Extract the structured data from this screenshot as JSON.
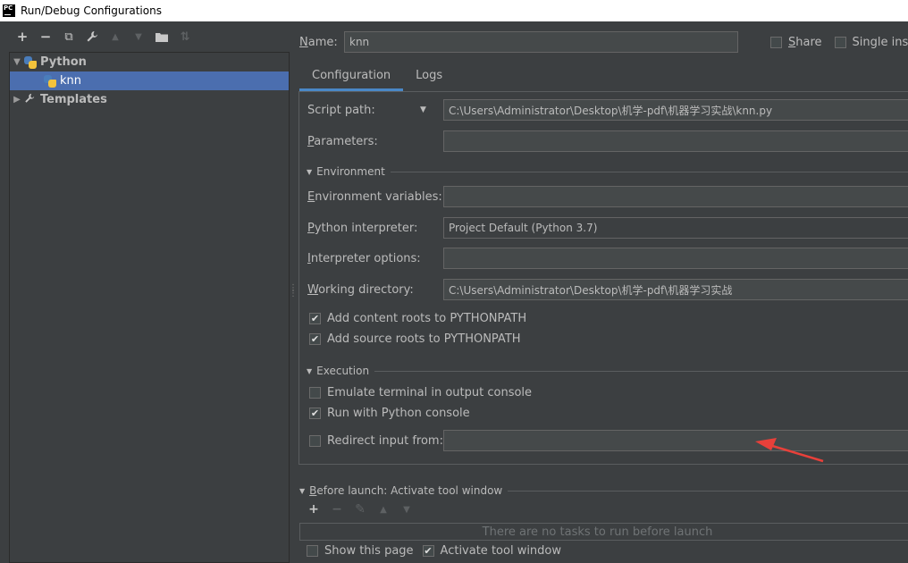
{
  "window": {
    "title": "Run/Debug Configurations",
    "logo_text": "PC"
  },
  "toolbar": {
    "add": "+",
    "remove": "−",
    "copy": "⧉",
    "edit_defaults": "🔧",
    "move_up": "▲",
    "move_down": "▼",
    "folder": "▣",
    "sort": "⇅"
  },
  "tree": {
    "python_label": "Python",
    "knn_label": "knn",
    "templates_label": "Templates"
  },
  "name_field": {
    "label": "Name:",
    "value": "knn"
  },
  "share": {
    "label": "Share",
    "checked": false
  },
  "single_instance": {
    "label": "Single instan",
    "checked": false
  },
  "tabs": [
    {
      "label": "Configuration"
    },
    {
      "label": "Logs"
    }
  ],
  "config": {
    "script_path": {
      "label": "Script path:",
      "value": "C:\\Users\\Administrator\\Desktop\\机学-pdf\\机器学习实战\\knn.py"
    },
    "parameters": {
      "label": "Parameters:",
      "value": ""
    },
    "environment_section": "Environment",
    "env_vars": {
      "label": "Environment variables:",
      "value": ""
    },
    "interpreter": {
      "label": "Python interpreter:",
      "value": "Project Default (Python 3.7)"
    },
    "interp_options": {
      "label": "Interpreter options:",
      "value": ""
    },
    "working_dir": {
      "label": "Working directory:",
      "value": "C:\\Users\\Administrator\\Desktop\\机学-pdf\\机器学习实战"
    },
    "add_content_roots": {
      "label": "Add content roots to PYTHONPATH",
      "checked": true
    },
    "add_source_roots": {
      "label": "Add source roots to PYTHONPATH",
      "checked": true
    },
    "execution_section": "Execution",
    "emulate_terminal": {
      "label": "Emulate terminal in output console",
      "checked": false
    },
    "run_with_console": {
      "label": "Run with Python console",
      "checked": true
    },
    "redirect_input": {
      "label": "Redirect input from:",
      "checked": false,
      "value": ""
    }
  },
  "before_launch": {
    "label": "Before launch: Activate tool window",
    "empty_text": "There are no tasks to run before launch",
    "add": "+",
    "remove": "−",
    "edit": "✎",
    "up": "▲",
    "down": "▼"
  },
  "show_this_page": {
    "label": "Show this page",
    "checked": false
  },
  "activate_tool_window": {
    "label": "Activate tool window",
    "checked": true
  },
  "check_mark": "✔",
  "colors": {
    "selection": "#4b6eaf",
    "tab_underline": "#4a88c7",
    "annotation": "#e8403a"
  }
}
